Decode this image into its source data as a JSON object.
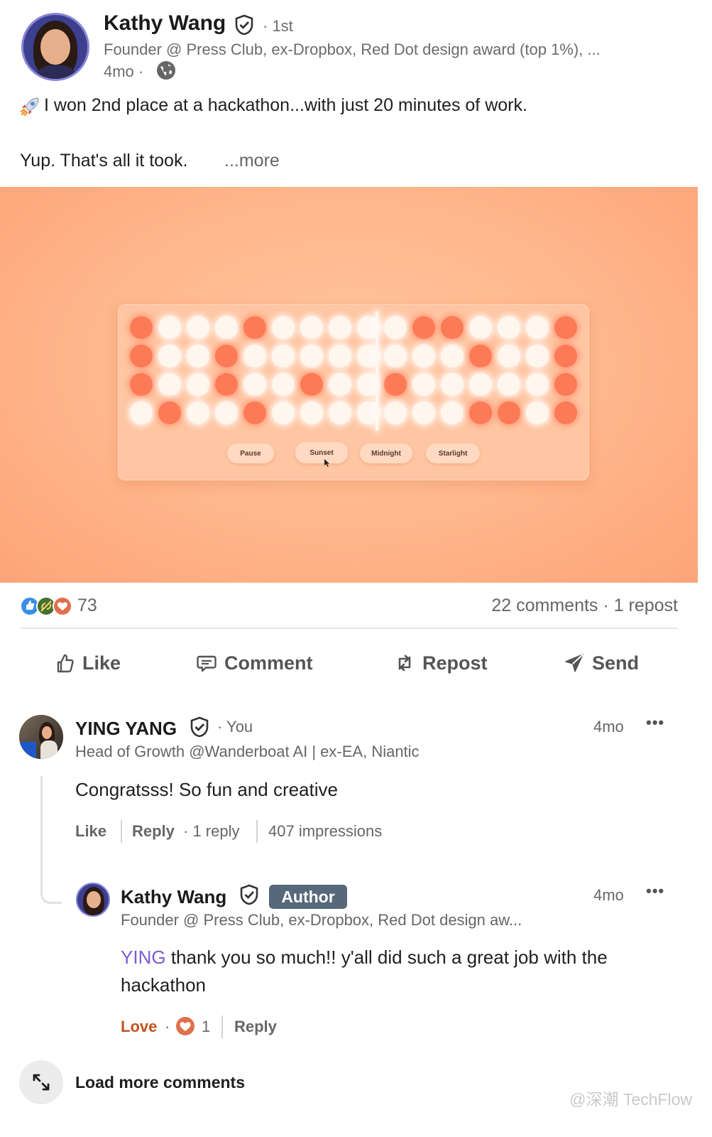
{
  "post": {
    "author_name": "Kathy Wang",
    "degree": "· 1st",
    "headline": "Founder @ Press Club, ex-Dropbox, Red Dot design award (top 1%), ...",
    "time": "4mo ·",
    "text_line1": "I won 2nd place at a hackathon...with just 20 minutes of work.",
    "text_line2": "Yup. That's all it took.",
    "more_link": "...more"
  },
  "media": {
    "buttons": [
      "Pause",
      "Sunset",
      "Midnight",
      "Starlight"
    ],
    "grid_colors": {
      "on": "#fd7a57",
      "off": "#fff6ee",
      "background": "#ffb58a"
    }
  },
  "stats": {
    "reactions_count": "73",
    "comments_reposts": "22 comments · 1 repost"
  },
  "actions": {
    "like": "Like",
    "comment": "Comment",
    "repost": "Repost",
    "send": "Send"
  },
  "comment1": {
    "name": "YING YANG",
    "you": "· You",
    "headline": "Head of Growth @Wanderboat AI | ex-EA, Niantic",
    "time": "4mo",
    "text": "Congratsss! So fun and creative",
    "like": "Like",
    "reply": "Reply",
    "reply_count": "· 1 reply",
    "impressions": "407 impressions"
  },
  "reply1": {
    "name": "Kathy Wang",
    "badge": "Author",
    "headline": "Founder @ Press Club, ex-Dropbox, Red Dot design aw...",
    "time": "4mo",
    "mention": "YING",
    "text_line1": "thank you so much!! y'all did such a great job with the",
    "text_line2": "hackathon",
    "love": "Love",
    "love_sep": "·",
    "love_count": "1",
    "reply": "Reply"
  },
  "load_more": "Load more comments",
  "watermark": "@深潮 TechFlow",
  "colors": {
    "mention": "#7b5bd6",
    "love": "#c0531e",
    "badge": "#56687a"
  }
}
